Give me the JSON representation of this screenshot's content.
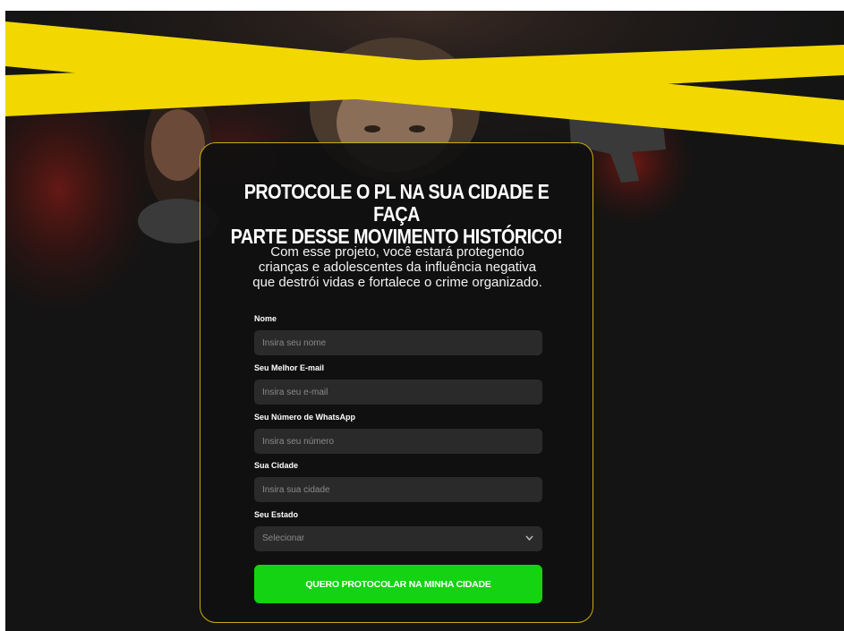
{
  "headline": {
    "line1": "PROTOCOLE O PL NA SUA CIDADE E FAÇA",
    "line2": "PARTE DESSE MOVIMENTO HISTÓRICO!"
  },
  "subheadline": {
    "line1": "Com esse projeto, você estará protegendo",
    "line2": "crianças e adolescentes da influência negativa",
    "line3": "que destrói vidas e fortalece o crime organizado."
  },
  "form": {
    "name": {
      "label": "Nome",
      "placeholder": "Insira seu nome"
    },
    "email": {
      "label": "Seu Melhor E-mail",
      "placeholder": "Insira seu e-mail"
    },
    "whatsapp": {
      "label": "Seu Número de WhatsApp",
      "placeholder": "Insira seu número"
    },
    "city": {
      "label": "Sua Cidade",
      "placeholder": "Insira sua cidade"
    },
    "state": {
      "label": "Seu Estado",
      "selected": "Selecionar"
    },
    "submit_label": "QUERO PROTOCOLAR NA MINHA CIDADE"
  },
  "colors": {
    "accent_yellow": "#f2d800",
    "card_border": "#c9ad12",
    "button_green": "#13d313",
    "background": "#141414",
    "input_bg": "#2a2a2a"
  },
  "icons": {
    "select_arrow": "chevron-down-icon"
  }
}
